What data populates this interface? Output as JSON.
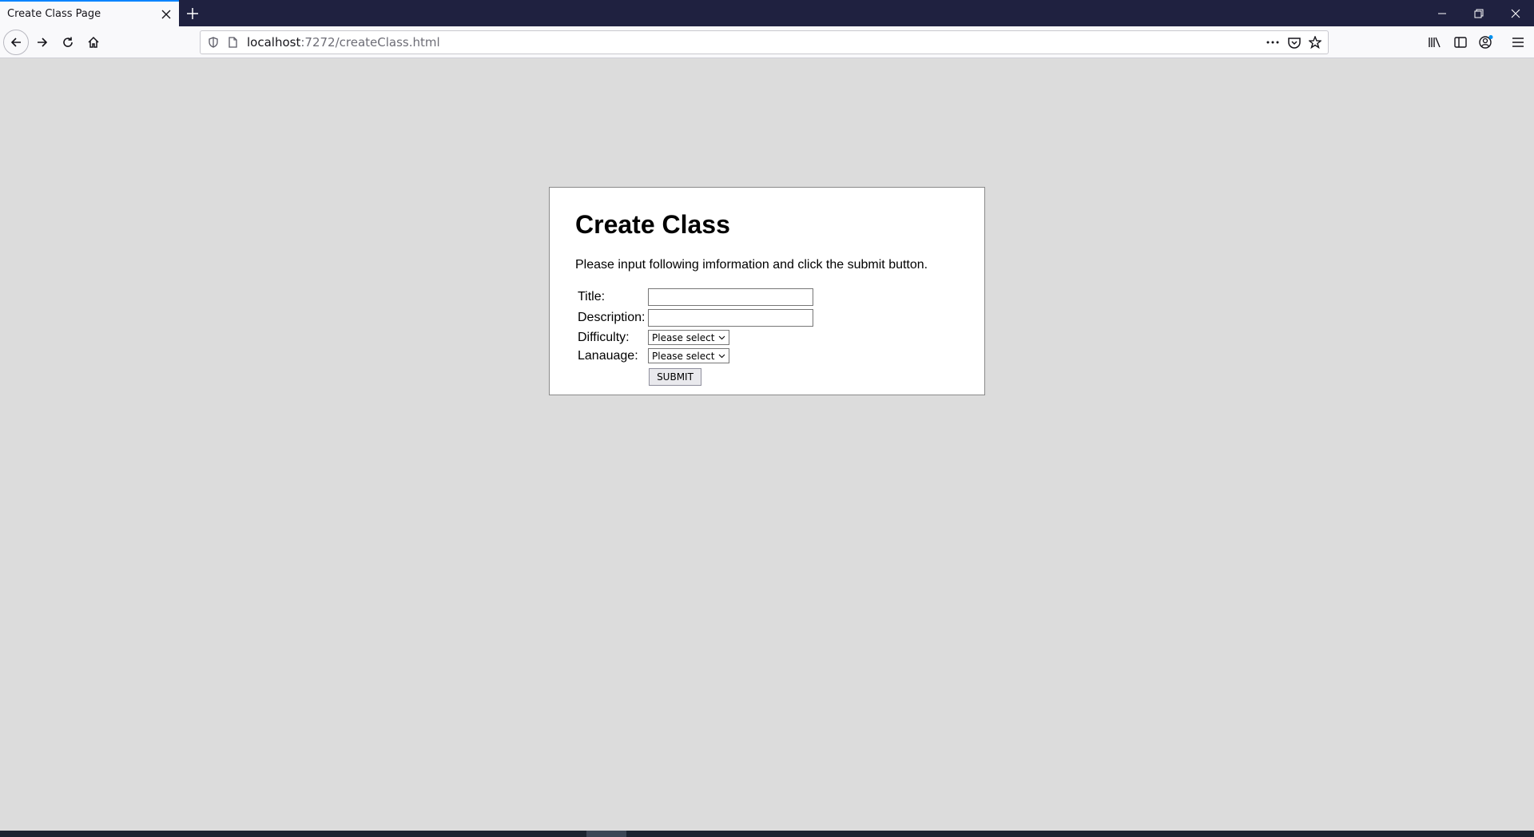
{
  "browser": {
    "tab": {
      "title": "Create Class Page"
    },
    "url": {
      "host": "localhost",
      "path": ":7272/createClass.html"
    }
  },
  "page": {
    "heading": "Create Class",
    "instructions": "Please input following imformation and click the submit button.",
    "form": {
      "title_label": "Title:",
      "title_value": "",
      "description_label": "Description:",
      "description_value": "",
      "difficulty_label": "Difficulty:",
      "difficulty_selected": "Please select",
      "language_label": "Lanauage:",
      "language_selected": "Please select",
      "submit_label": "SUBMIT"
    }
  },
  "colors": {
    "tabstrip_bg": "#1f2140",
    "active_tab_accent": "#0a84ff",
    "content_bg": "#dcdcdc",
    "card_bg": "#ffffff"
  },
  "icons": {
    "tab_close": "close-icon",
    "new_tab": "plus-icon",
    "back": "arrow-left-icon",
    "forward": "arrow-right-icon",
    "reload": "reload-icon",
    "home": "home-icon",
    "tracking": "shield-icon",
    "page_info": "page-icon",
    "page_actions": "more-icon",
    "pocket": "pocket-icon",
    "bookmark": "star-icon",
    "library": "library-icon",
    "sidebar": "sidebar-icon",
    "account": "account-icon",
    "menu": "hamburger-icon",
    "minimize": "minimize-icon",
    "restore": "restore-icon",
    "close_window": "close-window-icon"
  }
}
